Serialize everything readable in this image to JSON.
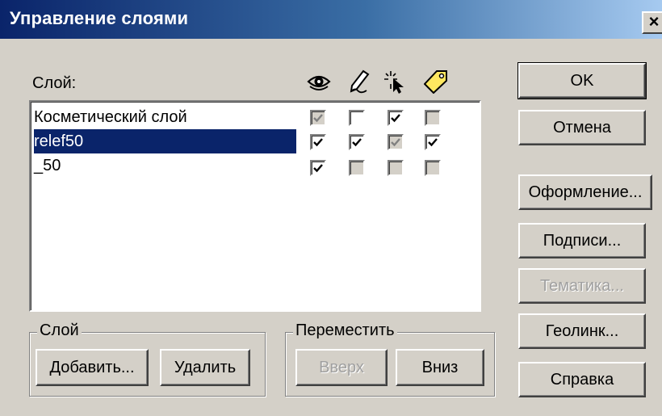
{
  "window": {
    "title": "Управление слоями",
    "close_glyph": "×"
  },
  "list": {
    "header": "Слой:",
    "columns": [
      "eye-icon",
      "pencil-icon",
      "cursor-icon",
      "tag-icon"
    ],
    "rows": [
      {
        "name": "Косметический слой",
        "selected": false,
        "checks": [
          {
            "checked": true,
            "disabled": true
          },
          {
            "checked": false,
            "disabled": false
          },
          {
            "checked": true,
            "disabled": false
          },
          {
            "checked": false,
            "disabled": true
          }
        ]
      },
      {
        "name": "relef50",
        "selected": true,
        "checks": [
          {
            "checked": true,
            "disabled": false
          },
          {
            "checked": true,
            "disabled": false
          },
          {
            "checked": true,
            "disabled": true
          },
          {
            "checked": true,
            "disabled": false
          }
        ]
      },
      {
        "name": "_50",
        "selected": false,
        "checks": [
          {
            "checked": true,
            "disabled": false
          },
          {
            "checked": false,
            "disabled": true
          },
          {
            "checked": false,
            "disabled": true
          },
          {
            "checked": false,
            "disabled": true
          }
        ]
      }
    ]
  },
  "layer_group": {
    "legend": "Слой",
    "add_label": "Добавить...",
    "delete_label": "Удалить"
  },
  "move_group": {
    "legend": "Переместить",
    "up_label": "Вверх",
    "down_label": "Вниз"
  },
  "buttons": {
    "ok": "OK",
    "cancel": "Отмена",
    "design": "Оформление...",
    "captions": "Подписи...",
    "thematic": "Тематика...",
    "geolink": "Геолинк...",
    "help": "Справка"
  },
  "colors": {
    "selection": "#0a246a",
    "face": "#d4d0c8",
    "title_start": "#0a246a",
    "title_end": "#a6caf0"
  }
}
